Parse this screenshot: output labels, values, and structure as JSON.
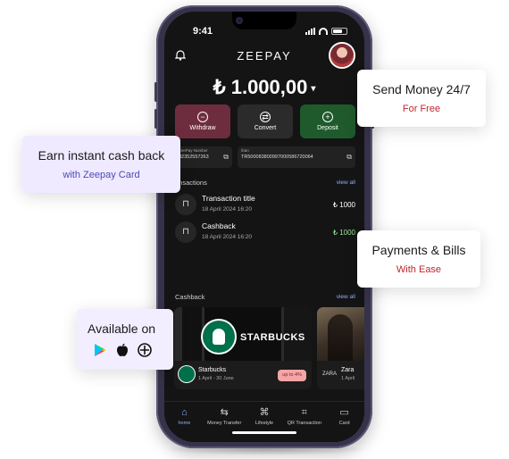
{
  "status_bar": {
    "time": "9:41"
  },
  "app": {
    "brand": "ZEEPAY",
    "balance": "₺ 1.000,00",
    "balance_caret": "▾"
  },
  "actions": [
    {
      "label": "Withdraw",
      "icon": "minus-circle-icon",
      "glyph": "−"
    },
    {
      "label": "Convert",
      "icon": "convert-icon",
      "glyph": "⇄"
    },
    {
      "label": "Deposit",
      "icon": "plus-circle-icon",
      "glyph": "+"
    }
  ],
  "accounts": [
    {
      "label": "ZeePay Number",
      "value": "82352557263"
    },
    {
      "label": "Iban",
      "value": "TR500083800997000586720064"
    }
  ],
  "transactions": {
    "title": "ansactions",
    "view_all": "view all",
    "items": [
      {
        "title": "Transaction title",
        "date": "18 April 2024  16:20",
        "amount": "₺ 1000",
        "positive": false
      },
      {
        "title": "Cashback",
        "date": "18 April 2024  16:20",
        "amount": "₺ 1000",
        "positive": true
      }
    ]
  },
  "cashback": {
    "title": "Cashback",
    "view_all": "view all",
    "cards": [
      {
        "name": "Starbucks",
        "date": "1 April - 30 June",
        "badge": "up to 4%",
        "banner": "STARBUCKS"
      },
      {
        "name": "Zara",
        "date": "1 April",
        "logo_text": "ZARA"
      }
    ]
  },
  "nav": [
    {
      "label": "home",
      "icon": "home-icon",
      "glyph": "⌂",
      "active": true
    },
    {
      "label": "Money Transfer",
      "icon": "transfer-icon",
      "glyph": "⇆",
      "active": false
    },
    {
      "label": "Lifestyle",
      "icon": "grid-icon",
      "glyph": "⌘",
      "active": false
    },
    {
      "label": "QR Transaction",
      "icon": "qr-icon",
      "glyph": "⌗",
      "active": false
    },
    {
      "label": "Card",
      "icon": "card-icon",
      "glyph": "▭",
      "active": false
    }
  ],
  "callouts": {
    "send": {
      "title": "Send Money 24/7",
      "subtitle": "For Free"
    },
    "earn": {
      "title": "Earn instant cash back",
      "subtitle": "with Zeepay Card"
    },
    "pay": {
      "title": "Payments & Bills",
      "subtitle": "With Ease"
    },
    "available": {
      "title": "Available on",
      "stores": [
        "google-play-icon",
        "apple-icon",
        "app-gallery-icon"
      ]
    }
  },
  "colors": {
    "withdraw": "#6e2d3e",
    "deposit": "#1f5a2c",
    "accent_red": "#c0262d",
    "accent_blue": "#4a49b8",
    "link_blue": "#8fb0ff"
  }
}
